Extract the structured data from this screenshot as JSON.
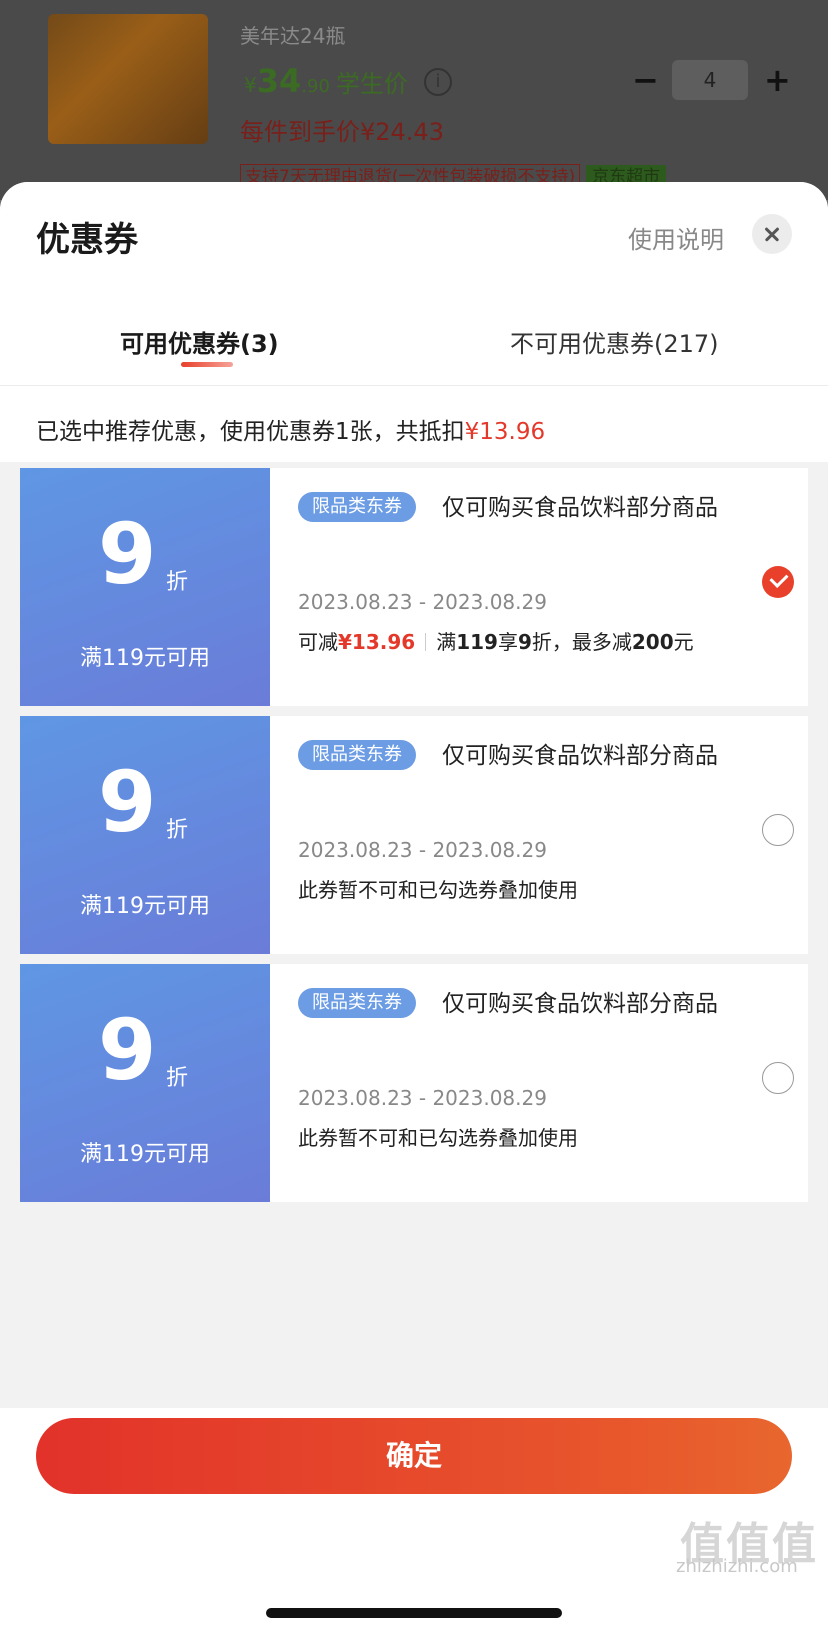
{
  "product": {
    "name": "美年达24瓶",
    "price_currency": "¥",
    "price_int": "34",
    "price_dec": ".90",
    "price_tag": "学生价",
    "info_icon": "info-icon",
    "each_price": "每件到手价¥24.43",
    "quantity": "4",
    "minus_label": "−",
    "plus_label": "+",
    "tag_return": "支持7天无理由退货(一次性包装破损不支持)",
    "tag_store": "京东超市"
  },
  "sheet": {
    "title": "优惠券",
    "help_link": "使用说明",
    "close_icon": "close-icon",
    "tabs": [
      {
        "label": "可用优惠券(3)",
        "active": true
      },
      {
        "label": "不可用优惠券(217)",
        "active": false
      }
    ],
    "summary_text": "已选中推荐优惠，使用优惠券1张，共抵扣",
    "summary_amount": "¥13.96",
    "accent_color": "#e4392a"
  },
  "coupons": [
    {
      "discount": "9",
      "unit": "折",
      "condition": "满119元可用",
      "badge": "限品类东券",
      "title": "仅可购买食品饮料部分商品",
      "date": "2023.08.23 - 2023.08.29",
      "deduct_label": "可减",
      "deduct_amount": "¥13.96",
      "rule_prefix": "满",
      "rule_threshold": "119",
      "rule_mid": "享",
      "rule_discount": "9",
      "rule_mid2": "折，最多减",
      "rule_max": "200",
      "rule_suffix": "元",
      "checked": true
    },
    {
      "discount": "9",
      "unit": "折",
      "condition": "满119元可用",
      "badge": "限品类东券",
      "title": "仅可购买食品饮料部分商品",
      "date": "2023.08.23 - 2023.08.29",
      "note": "此券暂不可和已勾选券叠加使用",
      "checked": false
    },
    {
      "discount": "9",
      "unit": "折",
      "condition": "满119元可用",
      "badge": "限品类东券",
      "title": "仅可购买食品饮料部分商品",
      "date": "2023.08.23 - 2023.08.29",
      "note": "此券暂不可和已勾选券叠加使用",
      "checked": false
    }
  ],
  "footer": {
    "confirm_label": "确定"
  },
  "watermark": {
    "logo": "值值值",
    "site": "zhizhizhi.com"
  }
}
